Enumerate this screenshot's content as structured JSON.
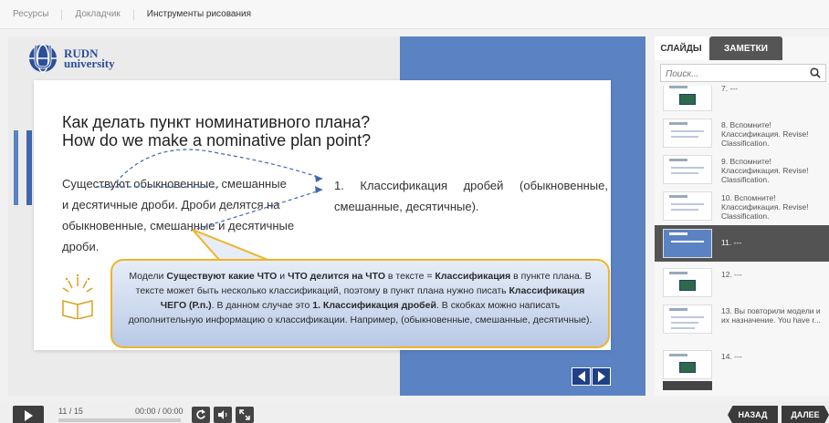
{
  "topbar": {
    "items": [
      "Ресурсы",
      "Докладчик",
      "Инструменты рисования"
    ]
  },
  "slide": {
    "logo": {
      "line1": "RUDN",
      "line2": "university"
    },
    "title_line1": "Как делать пункт номинативного плана?",
    "title_line2": "How do we make a nominative plan point?",
    "left_text": "Существуют обыкновенные, смешанные и десятичные дроби. Дроби делятся на обыкновенные, смешанные и десятичные дроби.",
    "right_text": "1. Классификация дробей (обыкновенные, смешанные, десятичные).",
    "callout": {
      "p1": "Модели ",
      "b1": "Существуют какие ЧТО",
      "p2": " и ",
      "b2": "ЧТО делится на ЧТО",
      "p3": " в тексте = ",
      "b3": "Классификация",
      "p4": " в пункте плана. В тексте может быть несколько классификаций, поэтому в пункт плана нужно писать ",
      "b4": "Классификация ЧЕГО (Р.п.)",
      "p5": ". В данном случае это ",
      "b5": "1. Классификация дробей",
      "p6": ". В скобках можно написать дополнительную информацию о классификации. Например, (обыкновенные, смешанные, десятичные)."
    }
  },
  "sidebar": {
    "tabs": [
      "СЛАЙДЫ",
      "ЗАМЕТКИ"
    ],
    "search_placeholder": "Поиск...",
    "slides": [
      {
        "label": "7. ---"
      },
      {
        "label": "8. Вспомните! Классификация. Revise! Classification."
      },
      {
        "label": "9. Вспомните! Классификация. Revise! Classification."
      },
      {
        "label": "10. Вспомните! Классификация. Revise! Classification."
      },
      {
        "label": "11. ---"
      },
      {
        "label": "12. ---"
      },
      {
        "label": "13. Вы повторили модели и их назначение. You have r..."
      },
      {
        "label": "14. ---"
      }
    ]
  },
  "player": {
    "counter": "11 / 15",
    "time": "00:00 / 00:00",
    "back_label": "НАЗАД",
    "next_label": "ДАЛЕЕ"
  },
  "colors": {
    "brand_blue": "#5b83c3",
    "dark_blue": "#1f3f86",
    "callout_border": "#f0b429",
    "active_slide": "#535353"
  },
  "icons": [
    "search-icon",
    "play-icon",
    "replay-icon",
    "volume-icon",
    "fullscreen-icon",
    "prev-slide-icon",
    "next-slide-icon",
    "book-icon",
    "rudn-logo-icon"
  ]
}
